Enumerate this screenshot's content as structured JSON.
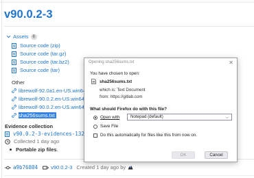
{
  "release": {
    "title": "v90.0.2-3",
    "assets_label": "Assets",
    "assets_count": "8",
    "sources": [
      "Source code (zip)",
      "Source code (tar.gz)",
      "Source code (tar.bz2)",
      "Source code (tar)"
    ],
    "other_label": "Other",
    "other_links": [
      "librewolf-92.0a1.en-US.win64-",
      "librewolf-90.0.2.en-US.win64.z",
      "librewolf-90.0.2.en-US.win64-",
      "sha256sums.txt"
    ],
    "evidence_title": "Evidence collection",
    "evidence_file": "v90.0.2-3-evidences-132394",
    "collected": "Collected 1 day ago",
    "bullet_text": "Portable zip files",
    "bullet_suffix": ".",
    "footer": {
      "commit": "a9b76804",
      "tag": "v90.0.2-3",
      "created": "Created 1 day ago by"
    }
  },
  "dialog": {
    "title": "Opening sha256sums.txt",
    "intro": "You have chosen to open:",
    "filename": "sha256sums.txt",
    "which_is": "which is: Text Document",
    "from": "from: https://gitlab.com",
    "question": "What should Firefox do with this file?",
    "open_with_label": "Open with",
    "open_with_app": "Notepad (default)",
    "save_file_label": "Save File",
    "auto_label": "Do this automatically for files like this from now on.",
    "ok_label": "OK",
    "cancel_label": "Cancel",
    "close_glyph": "✕"
  },
  "colors": {
    "link": "#1f75cb",
    "selection": "#3584e4"
  }
}
